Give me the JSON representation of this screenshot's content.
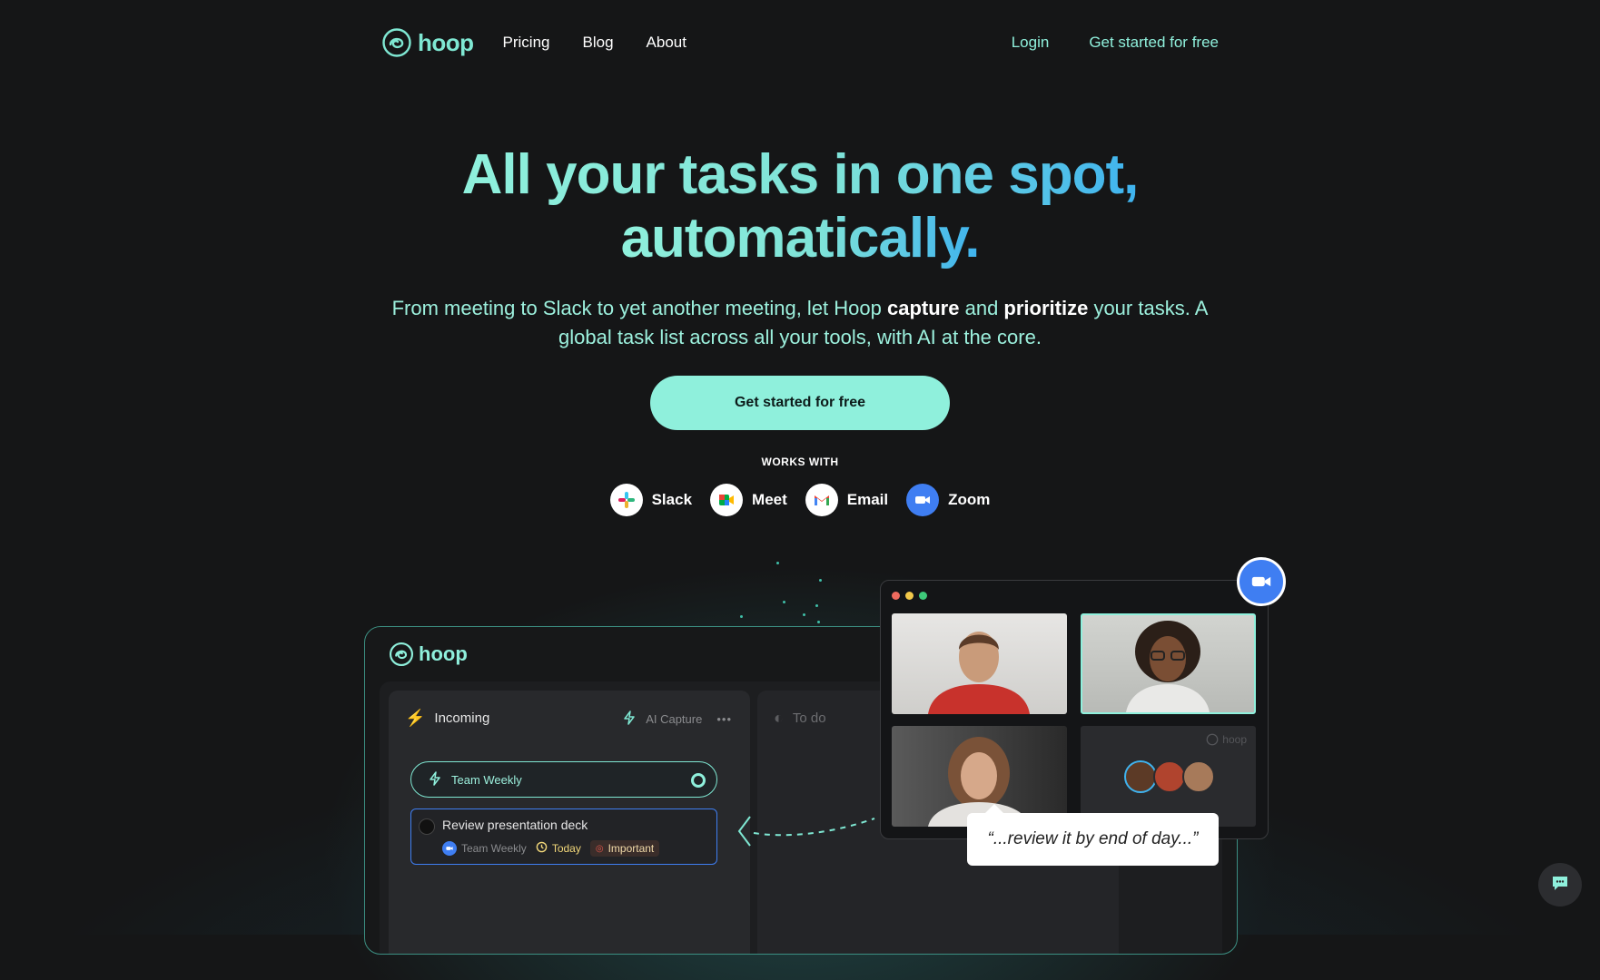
{
  "nav": {
    "logo_text": "hoop",
    "links": [
      "Pricing",
      "Blog",
      "About"
    ],
    "login": "Login",
    "get_started": "Get started for free"
  },
  "hero": {
    "title_line1": "All your tasks in one spot,",
    "title_line2": "automatically.",
    "subtitle_part1": "From meeting to Slack to yet another meeting, let Hoop ",
    "subtitle_bold1": "capture",
    "subtitle_part2": " and ",
    "subtitle_bold2": "prioritize",
    "subtitle_part3": " your tasks. A global task list across all your tools, with AI at the core.",
    "cta": "Get started for free"
  },
  "works_with": {
    "label": "WORKS WITH",
    "items": [
      {
        "name": "Slack",
        "icon": "slack-icon"
      },
      {
        "name": "Meet",
        "icon": "meet-icon"
      },
      {
        "name": "Email",
        "icon": "gmail-icon"
      },
      {
        "name": "Zoom",
        "icon": "zoom-icon"
      }
    ]
  },
  "app_preview": {
    "logo_text": "hoop",
    "incoming": {
      "title": "Incoming",
      "ai_capture": "AI Capture",
      "pill_label": "Team Weekly",
      "task": {
        "title": "Review presentation deck",
        "source": "Team Weekly",
        "due": "Today",
        "priority": "Important"
      }
    },
    "todo": {
      "title": "To do"
    }
  },
  "video_call": {
    "watermark": "hoop",
    "quote": "“...review it by end of day...”"
  },
  "colors": {
    "accent": "#8ff0dc",
    "background": "#151617",
    "zoom_blue": "#3f7ef2"
  }
}
